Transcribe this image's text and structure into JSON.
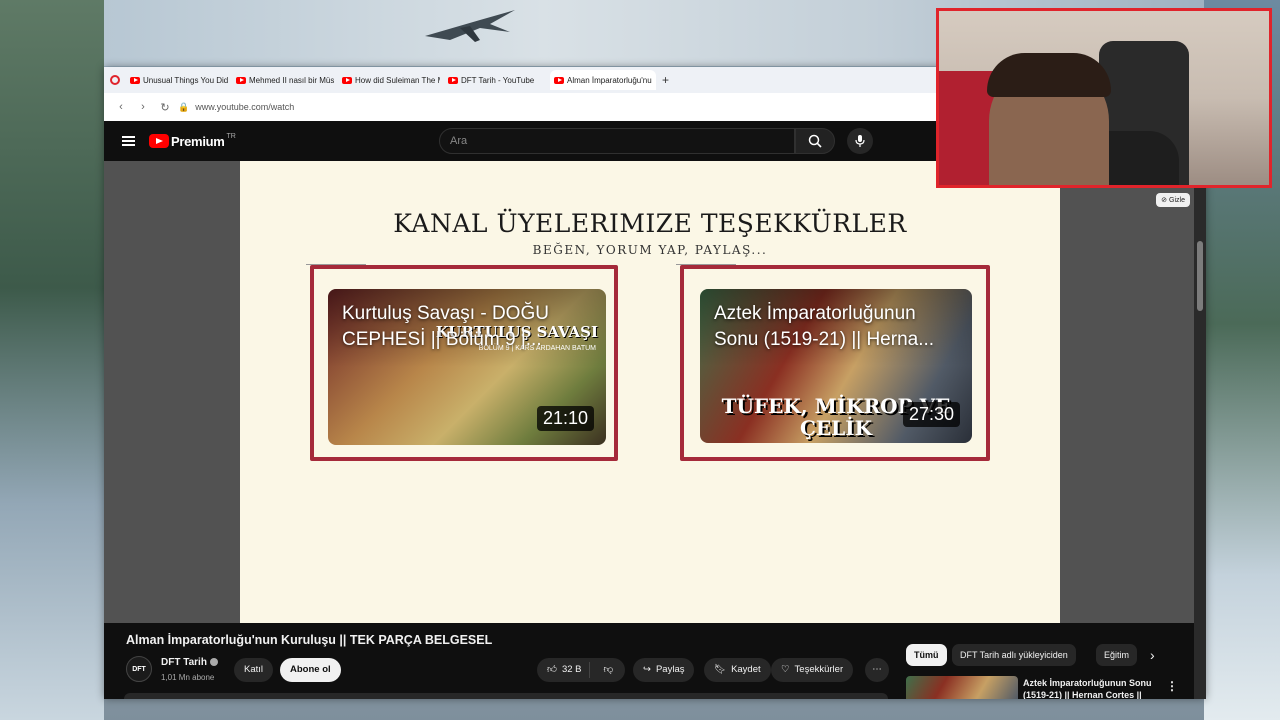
{
  "browser": {
    "tabs": [
      {
        "label": "Unusual Things You Didn't"
      },
      {
        "label": "Mehmed II nasıl bir Müslü"
      },
      {
        "label": "How did Suleiman The Ma"
      },
      {
        "label": "DFT Tarih - YouTube"
      },
      {
        "label": "Alman İmparatorluğu'nun"
      }
    ],
    "new_tab": "+",
    "url": "www.youtube.com/watch"
  },
  "masthead": {
    "logo_text": "Premium",
    "logo_region": "TR",
    "search_placeholder": "Ara"
  },
  "endscreen": {
    "title": "KANAL ÜYELERIMIZE TEŞEKKÜRLER",
    "subtitle": "BEĞEN, YORUM YAP, PAYLAŞ...",
    "hide_label": "Gizle",
    "cards": [
      {
        "title": "Kurtuluş Savaşı - DOĞU CEPHESİ || Bölüm 9 |...",
        "duration": "21:10",
        "tag": "KURTULUŞ SAVAŞI",
        "tag_sub": "BÖLÜM 9 | KARS ARDAHAN BATUM"
      },
      {
        "title": "Aztek İmparatorluğunun Sonu (1519-21) || Herna...",
        "duration": "27:30",
        "big_text": "TÜFEK, MİKROP VE ÇELİK"
      }
    ]
  },
  "video": {
    "title": "Alman İmparatorluğu'nun Kuruluşu || TEK PARÇA BELGESEL",
    "channel": "DFT Tarih",
    "channel_avatar": "DFT",
    "subscribers": "1,01 Mn abone",
    "join_label": "Katıl",
    "subscribe_label": "Abone ol",
    "like_count": "32 B",
    "share_label": "Paylaş",
    "save_label": "Kaydet",
    "thanks_label": "Teşekkürler",
    "more_label": "⋯"
  },
  "chips": [
    "Tümü",
    "DFT Tarih adlı yükleyiciden",
    "Eğitim"
  ],
  "recommendation": {
    "title": "Aztek İmparatorluğunun Sonu (1519-21) || Hernan Cortes ||"
  },
  "colors": {
    "accent_red": "#e0242b",
    "card_border": "#a52a3a",
    "yt_background": "#0f0f0f"
  }
}
